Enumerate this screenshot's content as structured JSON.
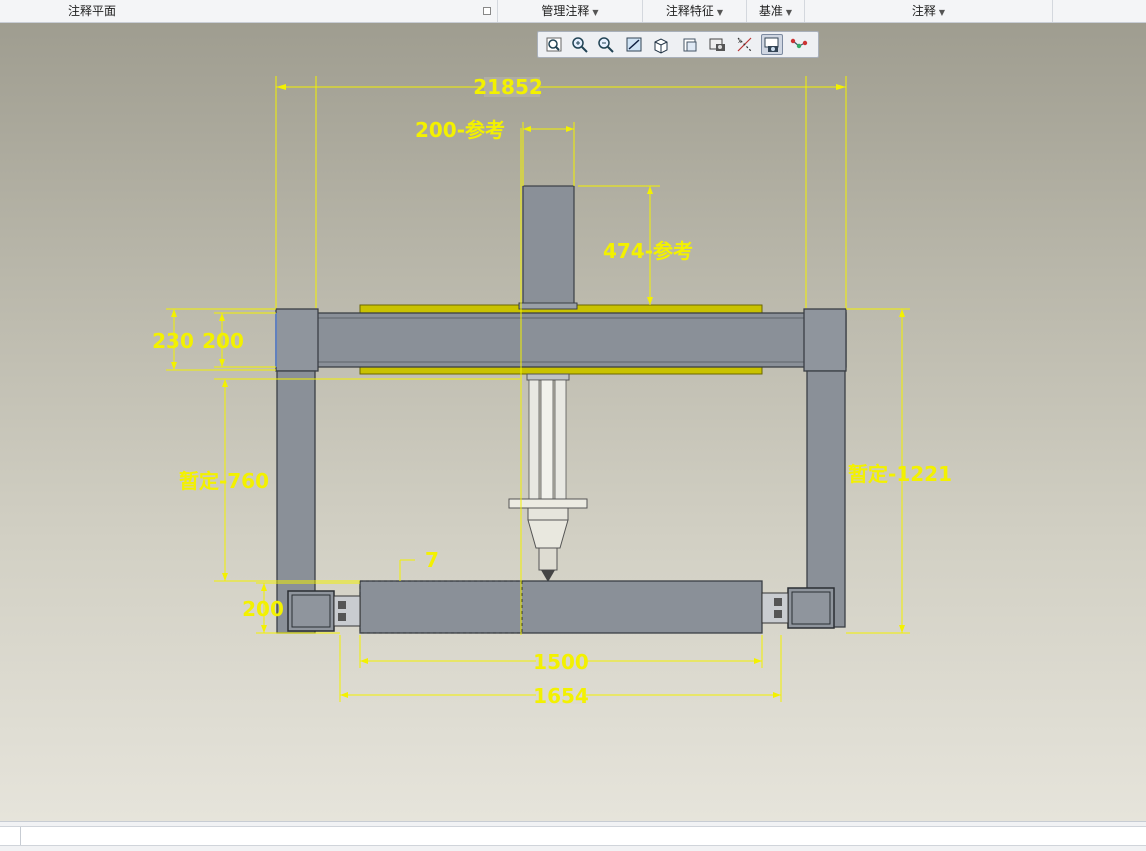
{
  "ribbon": {
    "groups": [
      {
        "label": "注释平面"
      },
      {
        "label": "管理注释"
      },
      {
        "label": "注释特征"
      },
      {
        "label": "基准"
      },
      {
        "label": "注释"
      }
    ]
  },
  "view_toolbar": {
    "buttons": [
      {
        "icon": "refit-icon"
      },
      {
        "icon": "zoom-in-icon"
      },
      {
        "icon": "zoom-out-icon"
      },
      {
        "icon": "repaint-icon"
      },
      {
        "icon": "display-style-icon"
      },
      {
        "icon": "saved-views-icon"
      },
      {
        "icon": "view-manager-icon"
      },
      {
        "icon": "datum-display-icon"
      },
      {
        "icon": "annotation-display-icon"
      },
      {
        "icon": "spin-center-icon"
      }
    ]
  },
  "dimensions": {
    "overall_width_overlap": "21852",
    "top_ref": "200-参考",
    "vertical_ref": "474-参考",
    "beam_outer": "230",
    "beam_inner": "200",
    "left_height": "暂定-760",
    "right_height": "暂定-1221",
    "gap": "7",
    "bottom_left": "200",
    "length_1500": "1500",
    "length_1654": "1654"
  },
  "colors": {
    "dimension": "#f3f100",
    "steel": "#8a9098",
    "steel_dark": "#3a3f45",
    "rail": "#c9c200"
  }
}
